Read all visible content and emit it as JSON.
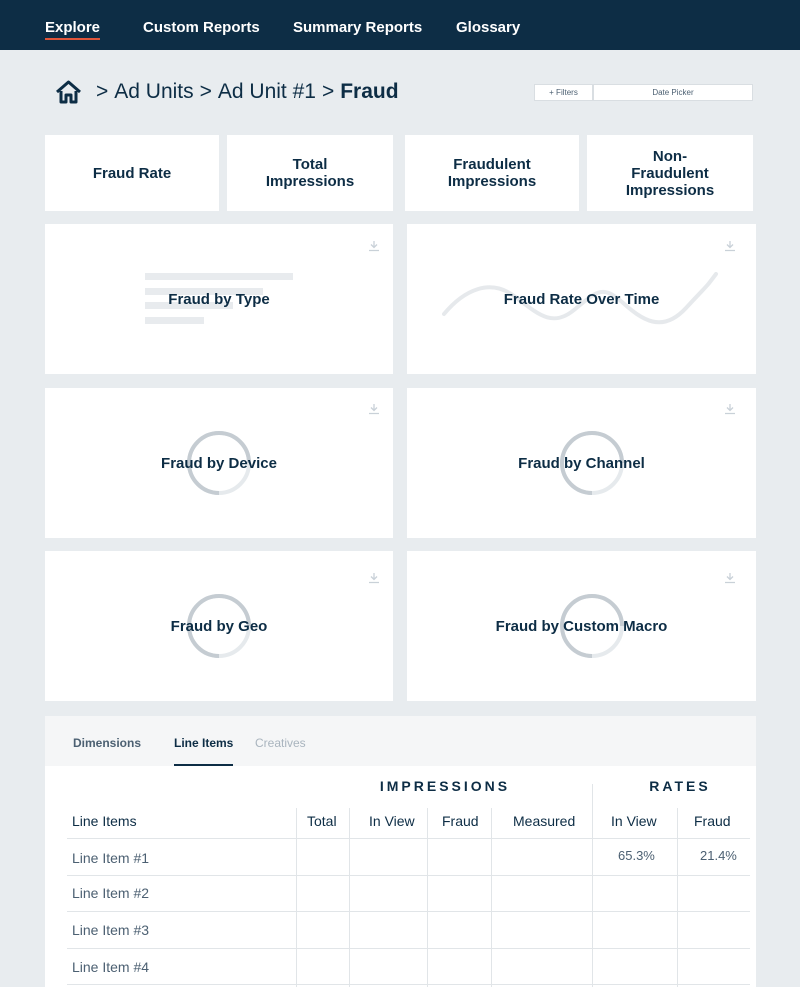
{
  "nav": {
    "items": [
      "Explore",
      "Custom Reports",
      "Summary Reports",
      "Glossary"
    ],
    "active_index": 0
  },
  "breadcrumb": {
    "home_icon": "home-icon",
    "items": [
      "Ad Units",
      "Ad Unit #1"
    ],
    "current": "Fraud",
    "separator": ">"
  },
  "controls": {
    "filters_label": "+ Filters",
    "date_picker_label": "Date Picker"
  },
  "kpis": [
    {
      "label": "Fraud Rate"
    },
    {
      "label": "Total Impressions"
    },
    {
      "label": "Fraudulent Impressions"
    },
    {
      "label": "Non-Fraudulent Impressions"
    }
  ],
  "cards": [
    {
      "title": "Fraud by Type",
      "icon": "bar-list-placeholder"
    },
    {
      "title": "Fraud Rate Over Time",
      "icon": "line-placeholder"
    },
    {
      "title": "Fraud by Device",
      "icon": "donut-placeholder"
    },
    {
      "title": "Fraud by Channel",
      "icon": "donut-placeholder"
    },
    {
      "title": "Fraud by Geo",
      "icon": "donut-placeholder"
    },
    {
      "title": "Fraud by Custom Macro",
      "icon": "donut-placeholder"
    }
  ],
  "table": {
    "tabs": [
      "Dimensions",
      "Line Items",
      "Creatives"
    ],
    "active_tab": 1,
    "group_headers": {
      "impressions": "IMPRESSIONS",
      "rates": "RATES"
    },
    "columns": [
      "Line Items",
      "Total",
      "In View",
      "Fraud",
      "Measured",
      "In View",
      "Fraud"
    ],
    "rows": [
      {
        "label": "Line Item #1",
        "rate_in_view": "65.3%",
        "rate_fraud": "21.4%"
      },
      {
        "label": "Line Item #2"
      },
      {
        "label": "Line Item #3"
      },
      {
        "label": "Line Item #4"
      }
    ]
  },
  "colors": {
    "nav_bg": "#0d2d45",
    "accent": "#e0553a",
    "page_bg": "#e8ecef",
    "text_primary": "#0d2d45",
    "text_secondary": "#4c6072"
  }
}
